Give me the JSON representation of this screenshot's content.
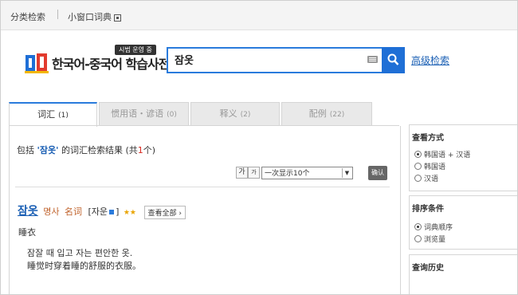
{
  "topbar": {
    "category_search": "分类检索",
    "mini_window": "小窗口词典"
  },
  "logo": {
    "text": "한국어-중국어 학습사전",
    "badge": "시범 운영 중"
  },
  "search": {
    "query": "잠옷",
    "advanced_label": "高级检索"
  },
  "tabs": [
    {
      "label": "词汇",
      "count": "(1)",
      "active": true
    },
    {
      "label": "惯用语・谚语",
      "count": "(0)"
    },
    {
      "label": "释义",
      "count": "(2)"
    },
    {
      "label": "配例",
      "count": "(22)"
    }
  ],
  "result": {
    "prefix": "包括",
    "keyword": "'잠옷'",
    "middle": "的词汇检索结果",
    "total_prefix": "(共",
    "total_count": "1",
    "total_suffix": "个)"
  },
  "filters": {
    "font_big": "가",
    "font_small": "가",
    "per_page": "一次显示10个",
    "confirm": "确认"
  },
  "entry": {
    "headword": "잠옷",
    "pos_ko": "명사",
    "pos_zh": "名词",
    "origin_open": "[자운",
    "origin_close": "]",
    "stars": "★★",
    "view_all": "查看全部 ›",
    "meaning": "睡衣",
    "example_ko": "잠잘 때 입고 자는 편안한 옷.",
    "example_zh": "睡觉时穿着睡的舒服的衣服。"
  },
  "sidebar": {
    "view_mode": {
      "title": "查看方式",
      "options": [
        "韩国语 + 汉语",
        "韩国语",
        "汉语"
      ],
      "selected": 0
    },
    "sort": {
      "title": "排序条件",
      "options": [
        "词典顺序",
        "浏览量"
      ],
      "selected": 0
    },
    "history": {
      "title": "查询历史"
    }
  },
  "colors": {
    "accent": "#2a7bdc",
    "link": "#1a5fb4",
    "count_red": "#d8261e",
    "pos": "#c0622b",
    "stars": "#e9a400"
  }
}
